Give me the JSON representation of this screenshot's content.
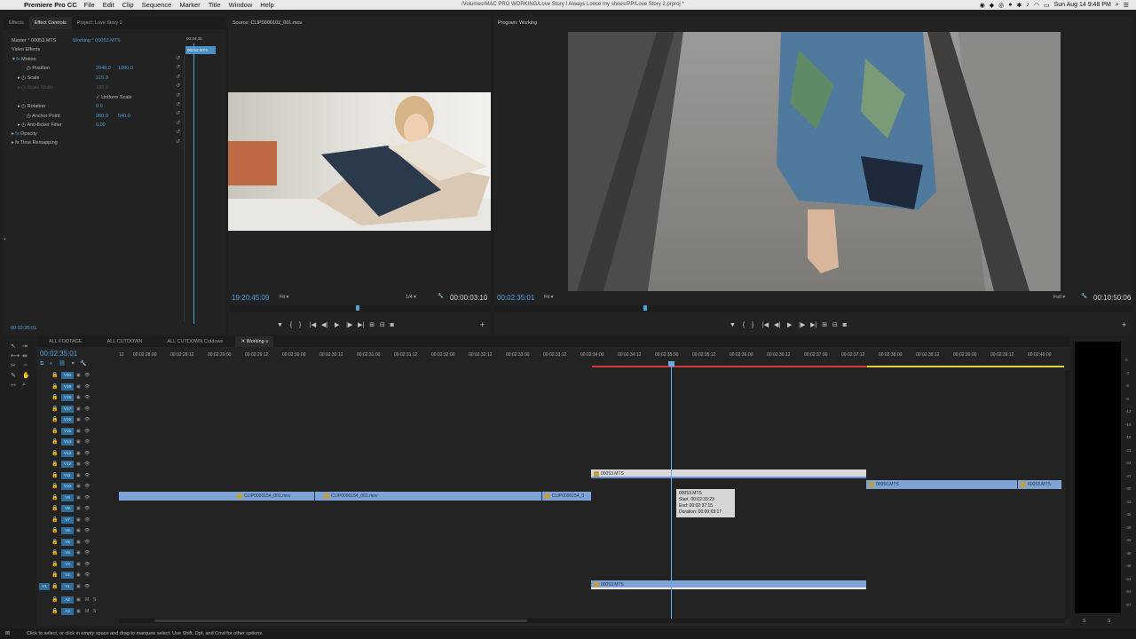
{
  "menubar": {
    "app_name": "Premiere Pro CC",
    "menus": [
      "File",
      "Edit",
      "Clip",
      "Sequence",
      "Marker",
      "Title",
      "Window",
      "Help"
    ],
    "path": "/Volumes/MAC PRO WORKING/Love Story I Always Loose my shoes/PP/Love Story 2.prproj *",
    "clock": "Sun Aug 14  9:48 PM"
  },
  "effects_panel": {
    "tabs": [
      "Effects",
      "Effect Controls",
      "Project: Love Story 2"
    ],
    "master": "Master * 00053.MTS",
    "working": "Working * 00053.MTS",
    "mini_timecode": "00:34:30",
    "mini_clip": "00053.MTS",
    "section": "Video Effects",
    "motion": "Motion",
    "position_label": "Position",
    "position_x": "2048.0",
    "position_y": "1080.0",
    "scale_label": "Scale",
    "scale_value": "215.0",
    "scale_width_label": "Scale Width",
    "scale_width_value": "100.0",
    "uniform_scale": "Uniform Scale",
    "rotation_label": "Rotation",
    "rotation_value": "0.0",
    "anchor_label": "Anchor Point",
    "anchor_x": "960.0",
    "anchor_y": "540.0",
    "antiflicker_label": "Anti-flicker Filter",
    "antiflicker_value": "0.00",
    "opacity": "Opacity",
    "time_remap": "Time Remapping",
    "bottom_timecode": "00:02:35:01"
  },
  "source": {
    "title": "Source: CLIP0000102_001.mov",
    "timecode": "19:20:45:09",
    "fit": "Fit",
    "quality": "1/4",
    "duration": "00:00:03:10"
  },
  "program": {
    "title": "Program: Working",
    "timecode": "00:02:35:01",
    "fit": "Fit",
    "quality": "Full",
    "duration": "00:10:50:06"
  },
  "timeline": {
    "tabs": [
      "ALL FOOTAGE",
      "ALL CUTDOWN",
      "ALL CUTDOWN Cutdown",
      "Working"
    ],
    "timecode": "00:02:35:01",
    "ruler": [
      "12",
      "00:02:28:00",
      "00:02:28:12",
      "00:02:29:00",
      "00:02:29:12",
      "00:02:30:00",
      "00:02:30:12",
      "00:02:31:00",
      "00:02:31:12",
      "00:02:32:00",
      "00:02:32:12",
      "00:02:33:00",
      "00:02:33:12",
      "00:02:34:00",
      "00:02:34:12",
      "00:02:35:00",
      "00:02:35:12",
      "00:02:36:00",
      "00:02:36:12",
      "00:02:37:00",
      "00:02:37:12",
      "00:02:38:00",
      "00:02:38:12",
      "00:02:39:00",
      "00:02:39:12",
      "00:02:40:00"
    ],
    "video_tracks": [
      "V20",
      "V19",
      "V18",
      "V17",
      "V16",
      "V15",
      "V14",
      "V13",
      "V12",
      "V11",
      "V10",
      "V9",
      "V8",
      "V7",
      "V6",
      "V5",
      "V4",
      "V3",
      "V2",
      "V1"
    ],
    "audio_tracks": [
      "A2",
      "A3"
    ],
    "source_patch": "V1",
    "mute": "M",
    "solo": "S",
    "clips": {
      "v11": "00053.MTS",
      "v10": "00050.MTS",
      "v10b": "00053.MTS",
      "v9a": "CLIP0000154_001.mov",
      "v9b": "CLIP0000154_001.mov",
      "v9c": "CLIP0000154_0",
      "v1": "00053.MTS"
    },
    "tooltip": {
      "name": "00053.MTS",
      "start": "Start: 00:02:33:23",
      "end": "End: 00:02:37:15",
      "duration": "Duration: 00:00:03:17"
    }
  },
  "meter": {
    "levels": [
      "0",
      "-3",
      "-6",
      "-9",
      "-12",
      "-15",
      "-18",
      "-21",
      "-24",
      "-27",
      "-30",
      "-33",
      "-36",
      "-39",
      "-42",
      "-45",
      "-48",
      "-51",
      "-54",
      "-57"
    ],
    "left": "S",
    "right": "S"
  },
  "status_bar": "Click to select, or click in empty space and drag to marquee select. Use Shift, Opt, and Cmd for other options."
}
